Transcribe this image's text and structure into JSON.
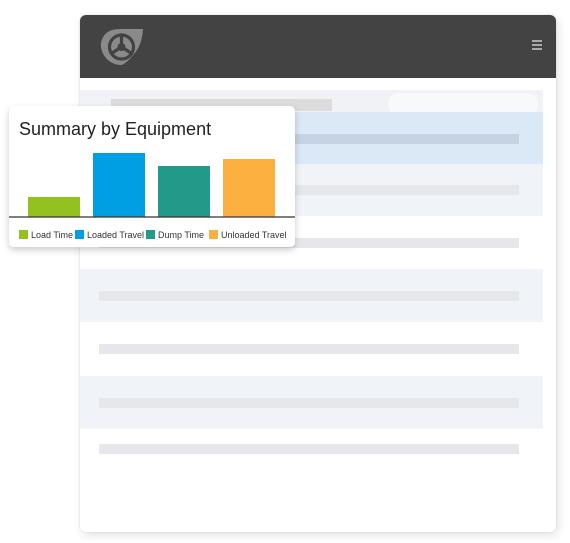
{
  "chart_card": {
    "title": "Summary by Equipment"
  },
  "chart_data": {
    "type": "bar",
    "title": "Summary by Equipment",
    "categories": [
      "Load Time",
      "Loaded Travel",
      "Dump Time",
      "Unloaded Travel"
    ],
    "series": [
      {
        "name": "Load Time",
        "values": [
          20
        ]
      },
      {
        "name": "Loaded Travel",
        "values": [
          64
        ]
      },
      {
        "name": "Dump Time",
        "values": [
          51
        ]
      },
      {
        "name": "Unloaded Travel",
        "values": [
          58
        ]
      }
    ],
    "values": [
      20,
      64,
      51,
      58
    ],
    "colors": [
      "#95c11f",
      "#009fe3",
      "#219a8a",
      "#fbb040"
    ],
    "legend_position": "bottom",
    "grid": false,
    "ylim": [
      0,
      64
    ]
  },
  "colors": {
    "topbar": "#434343",
    "row_selected": "#dbe8f6",
    "row_striped": "#f0f3f8",
    "row_plain": "#ffffff"
  },
  "icons": {
    "logo": "steering-wheel-logo-icon",
    "menu": "hamburger-menu-icon"
  },
  "table": {
    "rows": [
      {
        "state": "selected"
      },
      {
        "state": "striped"
      },
      {
        "state": "plain"
      },
      {
        "state": "striped"
      },
      {
        "state": "plain"
      },
      {
        "state": "striped"
      },
      {
        "state": "plain"
      }
    ]
  }
}
